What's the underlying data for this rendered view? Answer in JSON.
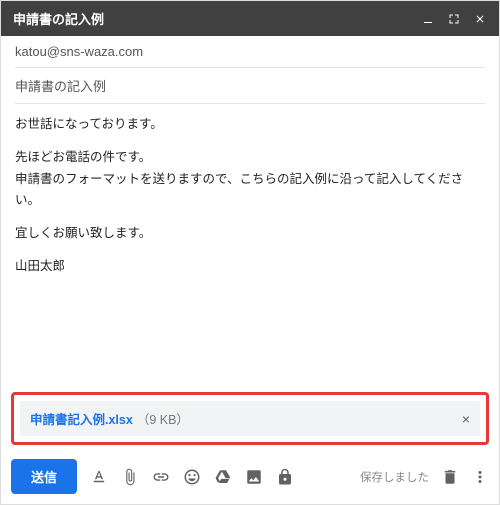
{
  "header": {
    "title": "申請書の記入例"
  },
  "fields": {
    "to": "katou@sns-waza.com",
    "subject": "申請書の記入例"
  },
  "body": {
    "line1": "お世話になっております。",
    "line2": "先ほどお電話の件です。",
    "line3": "申請書のフォーマットを送りますので、こちらの記入例に沿って記入してください。",
    "line4": "宜しくお願い致します。",
    "signature": "山田太郎"
  },
  "attachment": {
    "name": "申請書記入例.xlsx",
    "size": "（9 KB）"
  },
  "toolbar": {
    "send_label": "送信",
    "saved_label": "保存しました"
  }
}
